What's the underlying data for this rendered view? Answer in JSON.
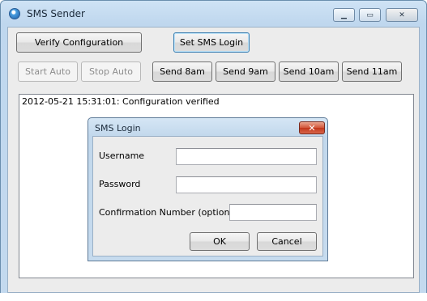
{
  "window": {
    "title": "SMS Sender",
    "icon": "globe-icon",
    "controls": {
      "minimize": "▁",
      "maximize": "▭",
      "close": "✕"
    }
  },
  "toolbar": {
    "verify_label": "Verify Configuration",
    "set_login_label": "Set SMS Login",
    "start_auto_label": "Start Auto",
    "stop_auto_label": "Stop Auto",
    "send_buttons": [
      "Send 8am",
      "Send 9am",
      "Send 10am",
      "Send 11am"
    ]
  },
  "log": {
    "lines": [
      "2012-05-21 15:31:01: Configuration verified"
    ]
  },
  "dialog": {
    "title": "SMS Login",
    "close_label": "✕",
    "username_label": "Username",
    "username_value": "",
    "password_label": "Password",
    "password_value": "",
    "confirmation_label": "Confirmation Number (optional)",
    "confirmation_value": "",
    "ok_label": "OK",
    "cancel_label": "Cancel"
  }
}
